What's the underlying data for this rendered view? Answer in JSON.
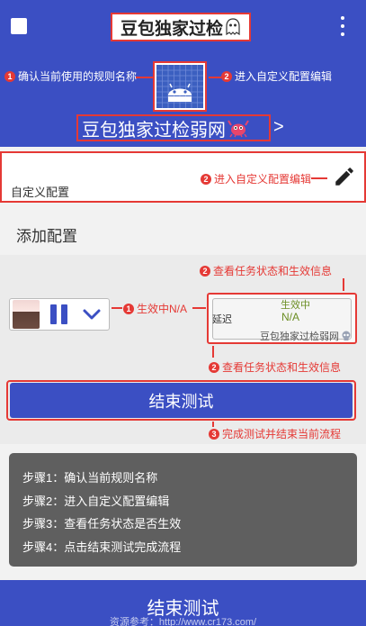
{
  "header": {
    "title": "豆包独家过检",
    "subtitle": "豆包独家过检弱网",
    "subtitle_chevron": ">",
    "hint_rule_name": "确认当前使用的规则名称",
    "hint_rule_num": "1",
    "hint_custom_config": "进入自定义配置编辑",
    "hint_custom_num": "2"
  },
  "config_card": {
    "label": "自定义配置",
    "hint": "进入自定义配置编辑",
    "hint_num": "2"
  },
  "add_config": {
    "label": "添加配置"
  },
  "status": {
    "hint_top": "查看任务状态和生效信息",
    "hint_top_num": "2",
    "effective_hint": "生效中N/A",
    "effective_hint_num": "1",
    "title": "生效中",
    "delay_label": "延迟",
    "value": "N/A",
    "footer": "豆包独家过检弱网",
    "hint_bottom": "查看任务状态和生效信息",
    "hint_bottom_num": "2"
  },
  "end_test": {
    "label": "结束测试",
    "hint": "完成测试并结束当前流程",
    "hint_num": "3"
  },
  "steps": [
    "步骤1：确认当前规则名称",
    "步骤2：进入自定义配置编辑",
    "步骤3：查看任务状态是否生效",
    "步骤4：点击结束测试完成流程"
  ],
  "bottom": {
    "title": "结束测试",
    "source": "资源参考：http://www.cr173.com/"
  },
  "colors": {
    "brand_blue": "#3b4fc3",
    "annotation_red": "#e53935",
    "status_green": "#6b8e23"
  },
  "icons": [
    "menu-icon",
    "more-vert-icon",
    "ghost-icon",
    "android-icon",
    "pencil-icon",
    "pause-icon",
    "chevron-down-icon",
    "skull-icon",
    "crab-icon"
  ]
}
